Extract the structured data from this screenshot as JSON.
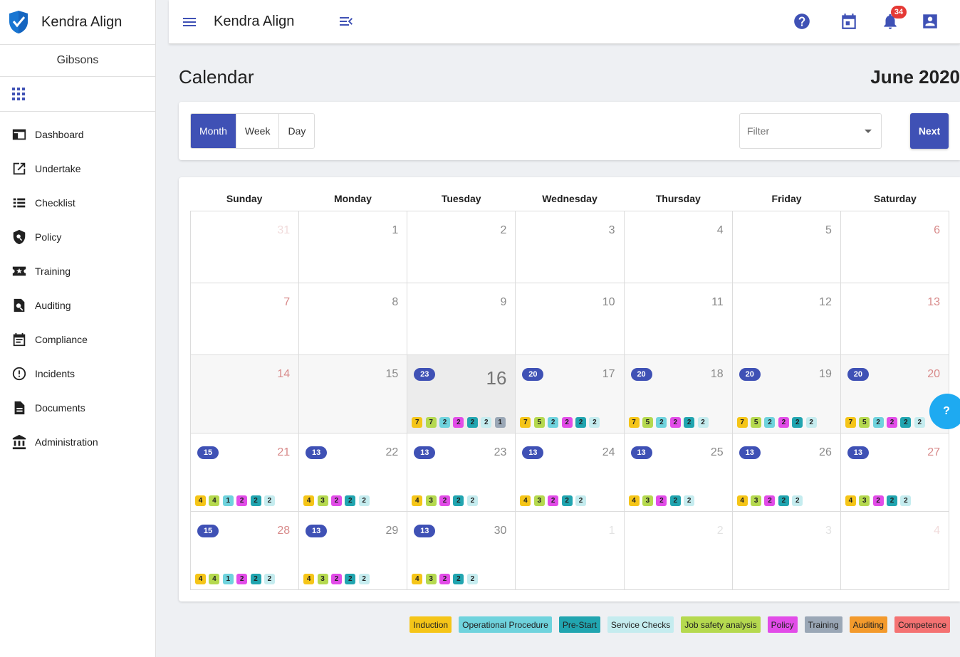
{
  "app": {
    "brand": "Kendra Align",
    "org": "Gibsons",
    "title": "Kendra Align",
    "notifications": "34"
  },
  "sidebar": {
    "items": [
      {
        "label": "Dashboard",
        "icon": "dashboard-icon"
      },
      {
        "label": "Undertake",
        "icon": "open-in-new-icon"
      },
      {
        "label": "Checklist",
        "icon": "list-icon"
      },
      {
        "label": "Policy",
        "icon": "policy-icon"
      },
      {
        "label": "Training",
        "icon": "star-ticket-icon"
      },
      {
        "label": "Auditing",
        "icon": "audit-search-icon"
      },
      {
        "label": "Compliance",
        "icon": "event-note-icon"
      },
      {
        "label": "Incidents",
        "icon": "alert-circle-icon"
      },
      {
        "label": "Documents",
        "icon": "document-icon"
      },
      {
        "label": "Administration",
        "icon": "bank-icon"
      }
    ]
  },
  "page": {
    "title": "Calendar",
    "month": "June 2020"
  },
  "toolbar": {
    "views": [
      "Month",
      "Week",
      "Day"
    ],
    "active_view": "Month",
    "filter_placeholder": "Filter",
    "next_label": "Next"
  },
  "calendar": {
    "weekdays": [
      "Sunday",
      "Monday",
      "Tuesday",
      "Wednesday",
      "Thursday",
      "Friday",
      "Saturday"
    ],
    "weeks": [
      [
        {
          "day": "31",
          "faded": true
        },
        {
          "day": "1"
        },
        {
          "day": "2"
        },
        {
          "day": "3"
        },
        {
          "day": "4"
        },
        {
          "day": "5"
        },
        {
          "day": "6"
        }
      ],
      [
        {
          "day": "7"
        },
        {
          "day": "8"
        },
        {
          "day": "9"
        },
        {
          "day": "10"
        },
        {
          "day": "11"
        },
        {
          "day": "12"
        },
        {
          "day": "13"
        }
      ],
      [
        {
          "day": "14",
          "shade": true
        },
        {
          "day": "15",
          "shade": true
        },
        {
          "day": "16",
          "today": true,
          "count": "23",
          "chips": [
            [
              "7",
              "induction"
            ],
            [
              "7",
              "jsa"
            ],
            [
              "2",
              "operational"
            ],
            [
              "2",
              "policy"
            ],
            [
              "2",
              "prestart"
            ],
            [
              "2",
              "service"
            ],
            [
              "1",
              "training"
            ]
          ]
        },
        {
          "day": "17",
          "shade": true,
          "count": "20",
          "chips": [
            [
              "7",
              "induction"
            ],
            [
              "5",
              "jsa"
            ],
            [
              "2",
              "operational"
            ],
            [
              "2",
              "policy"
            ],
            [
              "2",
              "prestart"
            ],
            [
              "2",
              "service"
            ]
          ]
        },
        {
          "day": "18",
          "shade": true,
          "count": "20",
          "chips": [
            [
              "7",
              "induction"
            ],
            [
              "5",
              "jsa"
            ],
            [
              "2",
              "operational"
            ],
            [
              "2",
              "policy"
            ],
            [
              "2",
              "prestart"
            ],
            [
              "2",
              "service"
            ]
          ]
        },
        {
          "day": "19",
          "shade": true,
          "count": "20",
          "chips": [
            [
              "7",
              "induction"
            ],
            [
              "5",
              "jsa"
            ],
            [
              "2",
              "operational"
            ],
            [
              "2",
              "policy"
            ],
            [
              "2",
              "prestart"
            ],
            [
              "2",
              "service"
            ]
          ]
        },
        {
          "day": "20",
          "shade": true,
          "count": "20",
          "chips": [
            [
              "7",
              "induction"
            ],
            [
              "5",
              "jsa"
            ],
            [
              "2",
              "operational"
            ],
            [
              "2",
              "policy"
            ],
            [
              "2",
              "prestart"
            ],
            [
              "2",
              "service"
            ]
          ]
        }
      ],
      [
        {
          "day": "21",
          "count": "15",
          "chips": [
            [
              "4",
              "induction"
            ],
            [
              "4",
              "jsa"
            ],
            [
              "1",
              "operational"
            ],
            [
              "2",
              "policy"
            ],
            [
              "2",
              "prestart"
            ],
            [
              "2",
              "service"
            ]
          ]
        },
        {
          "day": "22",
          "count": "13",
          "chips": [
            [
              "4",
              "induction"
            ],
            [
              "3",
              "jsa"
            ],
            [
              "2",
              "policy"
            ],
            [
              "2",
              "prestart"
            ],
            [
              "2",
              "service"
            ]
          ]
        },
        {
          "day": "23",
          "count": "13",
          "chips": [
            [
              "4",
              "induction"
            ],
            [
              "3",
              "jsa"
            ],
            [
              "2",
              "policy"
            ],
            [
              "2",
              "prestart"
            ],
            [
              "2",
              "service"
            ]
          ]
        },
        {
          "day": "24",
          "count": "13",
          "chips": [
            [
              "4",
              "induction"
            ],
            [
              "3",
              "jsa"
            ],
            [
              "2",
              "policy"
            ],
            [
              "2",
              "prestart"
            ],
            [
              "2",
              "service"
            ]
          ]
        },
        {
          "day": "25",
          "count": "13",
          "chips": [
            [
              "4",
              "induction"
            ],
            [
              "3",
              "jsa"
            ],
            [
              "2",
              "policy"
            ],
            [
              "2",
              "prestart"
            ],
            [
              "2",
              "service"
            ]
          ]
        },
        {
          "day": "26",
          "count": "13",
          "chips": [
            [
              "4",
              "induction"
            ],
            [
              "3",
              "jsa"
            ],
            [
              "2",
              "policy"
            ],
            [
              "2",
              "prestart"
            ],
            [
              "2",
              "service"
            ]
          ]
        },
        {
          "day": "27",
          "count": "13",
          "chips": [
            [
              "4",
              "induction"
            ],
            [
              "3",
              "jsa"
            ],
            [
              "2",
              "policy"
            ],
            [
              "2",
              "prestart"
            ],
            [
              "2",
              "service"
            ]
          ]
        }
      ],
      [
        {
          "day": "28",
          "count": "15",
          "chips": [
            [
              "4",
              "induction"
            ],
            [
              "4",
              "jsa"
            ],
            [
              "1",
              "operational"
            ],
            [
              "2",
              "policy"
            ],
            [
              "2",
              "prestart"
            ],
            [
              "2",
              "service"
            ]
          ]
        },
        {
          "day": "29",
          "count": "13",
          "chips": [
            [
              "4",
              "induction"
            ],
            [
              "3",
              "jsa"
            ],
            [
              "2",
              "policy"
            ],
            [
              "2",
              "prestart"
            ],
            [
              "2",
              "service"
            ]
          ]
        },
        {
          "day": "30",
          "count": "13",
          "chips": [
            [
              "4",
              "induction"
            ],
            [
              "3",
              "jsa"
            ],
            [
              "2",
              "policy"
            ],
            [
              "2",
              "prestart"
            ],
            [
              "2",
              "service"
            ]
          ]
        },
        {
          "day": "1",
          "faded": true
        },
        {
          "day": "2",
          "faded": true
        },
        {
          "day": "3",
          "faded": true
        },
        {
          "day": "4",
          "faded": true
        }
      ]
    ]
  },
  "legend": [
    {
      "key": "induction",
      "label": "Induction",
      "color": "#f5c518"
    },
    {
      "key": "operational",
      "label": "Operational Procedure",
      "color": "#6fd3dd"
    },
    {
      "key": "prestart",
      "label": "Pre-Start",
      "color": "#21a5b0"
    },
    {
      "key": "service",
      "label": "Service Checks",
      "color": "#c5ecef"
    },
    {
      "key": "jsa",
      "label": "Job safety analysis",
      "color": "#b5d94f"
    },
    {
      "key": "policy",
      "label": "Policy",
      "color": "#e24ce8"
    },
    {
      "key": "training",
      "label": "Training",
      "color": "#9aa7b6"
    },
    {
      "key": "auditing",
      "label": "Auditing",
      "color": "#f39a2c"
    },
    {
      "key": "competence",
      "label": "Competence",
      "color": "#f47272"
    }
  ],
  "help_label": "?"
}
